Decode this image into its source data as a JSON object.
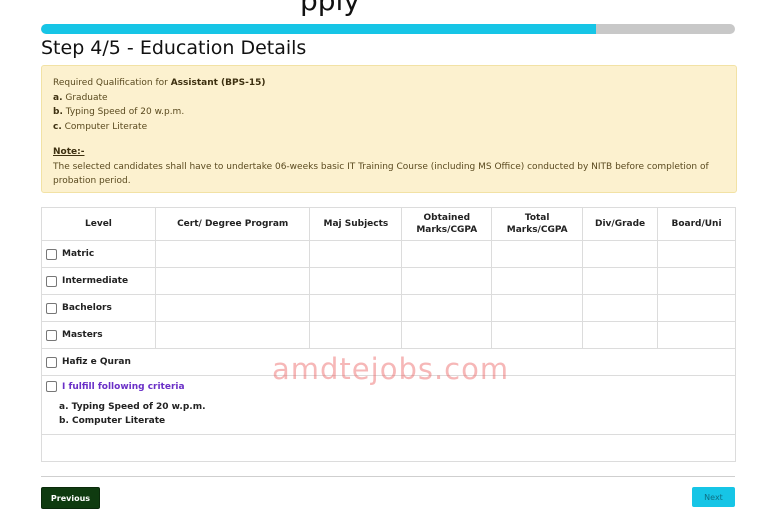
{
  "header": {
    "title_fragment": "pply"
  },
  "progress": {
    "fraction": 0.8
  },
  "step": {
    "title": "Step 4/5 - Education Details"
  },
  "notice": {
    "intro": "Required Qualification for ",
    "position": "Assistant (BPS-15)",
    "requirements": [
      {
        "marker": "a.",
        "text": "Graduate"
      },
      {
        "marker": "b.",
        "text": "Typing Speed of 20 w.p.m."
      },
      {
        "marker": "c.",
        "text": "Computer Literate"
      }
    ],
    "note_label": "Note:-",
    "note_text": "The selected candidates shall have to undertake 06-weeks basic IT Training Course (including MS Office) conducted by NITB before completion of probation period."
  },
  "table": {
    "headers": [
      "Level",
      "Cert/ Degree Program",
      "Maj Subjects",
      "Obtained Marks/CGPA",
      "Total Marks/CGPA",
      "Div/Grade",
      "Board/Uni"
    ],
    "levels": [
      "Matric",
      "Intermediate",
      "Bachelors",
      "Masters"
    ],
    "hafiz_label": "Hafiz e Quran",
    "criteria_label": "I fulfill following criteria",
    "criteria_items": [
      "a. Typing Speed of 20 w.p.m.",
      "b. Computer Literate"
    ]
  },
  "watermark": "amdtejobs.com",
  "buttons": {
    "previous": "Previous",
    "next": "Next"
  },
  "colors": {
    "progress_fill": "#16c5e6",
    "progress_track": "#c8c8c8",
    "notice_bg": "#fcf1cf",
    "previous_bg": "#0f3b10",
    "next_bg": "#16c5e6",
    "criteria_text": "#6a2fc7"
  }
}
